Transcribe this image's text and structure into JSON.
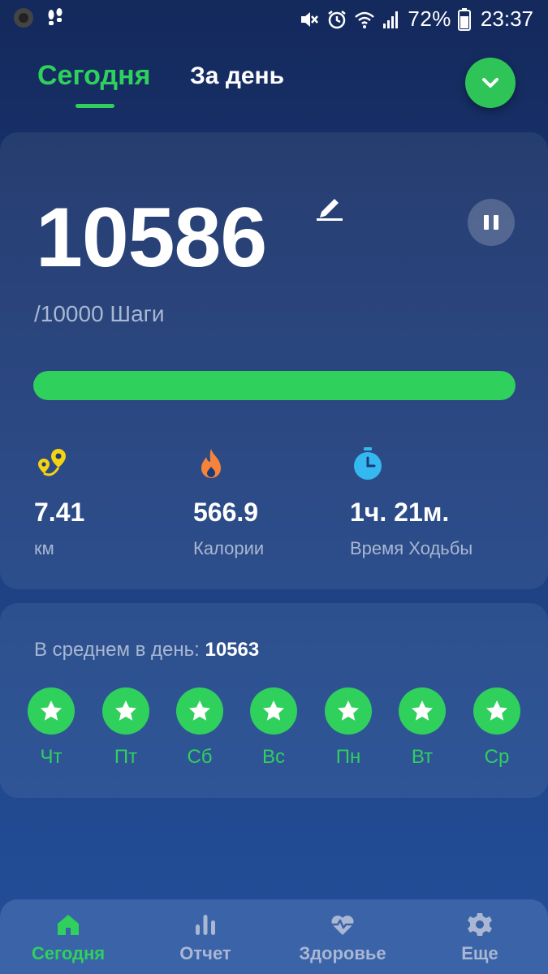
{
  "status_bar": {
    "battery_percent": "72%",
    "time": "23:37"
  },
  "tabs": {
    "today": "Сегодня",
    "per_day": "За день"
  },
  "steps": {
    "count": "10586",
    "goal_text": "/10000 Шаги",
    "progress_fraction": 1.0
  },
  "stats": [
    {
      "value": "7.41",
      "label": "км",
      "icon": "route-pin-icon"
    },
    {
      "value": "566.9",
      "label": "Калории",
      "icon": "flame-icon"
    },
    {
      "value": "1ч. 21м.",
      "label": "Время Ходьбы",
      "icon": "stopwatch-icon"
    }
  ],
  "average": {
    "label": "В среднем в день: ",
    "value": "10563"
  },
  "days": [
    {
      "label": "Чт"
    },
    {
      "label": "Пт"
    },
    {
      "label": "Сб"
    },
    {
      "label": "Вс"
    },
    {
      "label": "Пн"
    },
    {
      "label": "Вт"
    },
    {
      "label": "Ср"
    }
  ],
  "nav": [
    {
      "label": "Сегодня",
      "icon": "home-icon",
      "active": true
    },
    {
      "label": "Отчет",
      "icon": "bar-chart-icon",
      "active": false
    },
    {
      "label": "Здоровье",
      "icon": "heart-pulse-icon",
      "active": false
    },
    {
      "label": "Еще",
      "icon": "gear-icon",
      "active": false
    }
  ],
  "colors": {
    "accent": "#2fd05c",
    "background": "#1b3a78",
    "muted_text": "#a9b7d3",
    "route_icon": "#f5d312",
    "flame_icon": "#f5843a",
    "stopwatch_icon": "#35b8f0"
  }
}
